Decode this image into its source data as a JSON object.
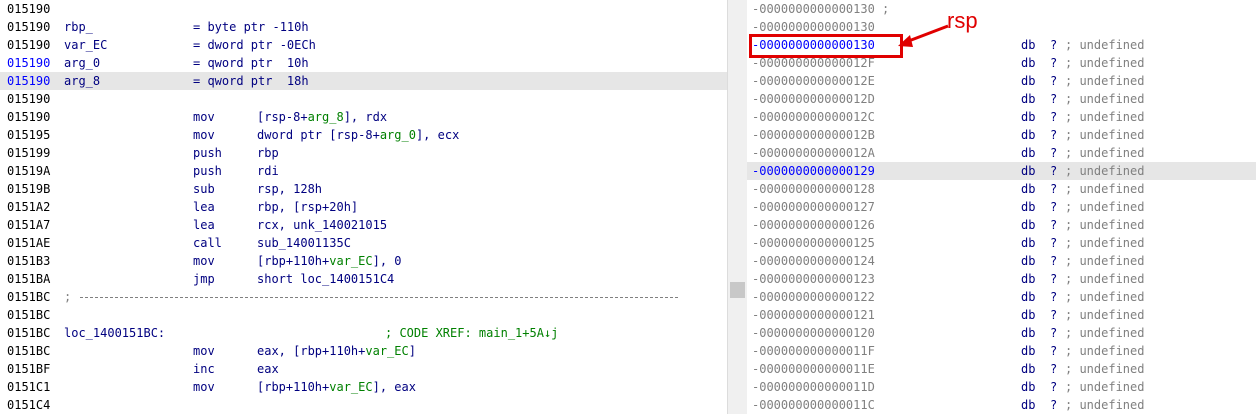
{
  "disasm": {
    "rows": [
      {
        "addr": "015190",
        "kind": "blank"
      },
      {
        "addr": "015190",
        "kind": "var",
        "name": "rbp_",
        "def": "= byte ptr -110h"
      },
      {
        "addr": "015190",
        "kind": "var",
        "name": "var_EC",
        "def": "= dword ptr -0ECh"
      },
      {
        "addr": "015190",
        "kind": "var",
        "name": "arg_0",
        "def": "= qword ptr  10h",
        "blue": true
      },
      {
        "addr": "015190",
        "kind": "var",
        "name": "arg_8",
        "def": "= qword ptr  18h",
        "blue": true,
        "highlight": true
      },
      {
        "addr": "015190",
        "kind": "blank"
      },
      {
        "addr": "015190",
        "kind": "ins",
        "mn": "mov",
        "ops": [
          [
            "[rsp-8+",
            ""
          ],
          [
            "arg_8",
            "var"
          ],
          [
            "], rdx",
            ""
          ]
        ]
      },
      {
        "addr": "015195",
        "kind": "ins",
        "mn": "mov",
        "ops": [
          [
            "dword ptr [rsp-8+",
            ""
          ],
          [
            "arg_0",
            "var"
          ],
          [
            "], ecx",
            ""
          ]
        ]
      },
      {
        "addr": "015199",
        "kind": "ins",
        "mn": "push",
        "ops": [
          [
            "rbp",
            ""
          ]
        ]
      },
      {
        "addr": "01519A",
        "kind": "ins",
        "mn": "push",
        "ops": [
          [
            "rdi",
            ""
          ]
        ]
      },
      {
        "addr": "01519B",
        "kind": "ins",
        "mn": "sub",
        "ops": [
          [
            "rsp, 128h",
            ""
          ]
        ]
      },
      {
        "addr": "0151A2",
        "kind": "ins",
        "mn": "lea",
        "ops": [
          [
            "rbp, [rsp+20h]",
            ""
          ]
        ]
      },
      {
        "addr": "0151A7",
        "kind": "ins",
        "mn": "lea",
        "ops": [
          [
            "rcx, unk_140021015",
            ""
          ]
        ]
      },
      {
        "addr": "0151AE",
        "kind": "ins",
        "mn": "call",
        "ops": [
          [
            "sub_14001135C",
            ""
          ]
        ]
      },
      {
        "addr": "0151B3",
        "kind": "ins",
        "mn": "mov",
        "ops": [
          [
            "[rbp+110h+",
            ""
          ],
          [
            "var_EC",
            "var"
          ],
          [
            "], 0",
            ""
          ]
        ]
      },
      {
        "addr": "0151BA",
        "kind": "ins",
        "mn": "jmp",
        "ops": [
          [
            "short loc_1400151C4",
            ""
          ]
        ]
      },
      {
        "addr": "0151BC",
        "kind": "sep",
        "text": ";"
      },
      {
        "addr": "0151BC",
        "kind": "blank"
      },
      {
        "addr": "0151BC",
        "kind": "label",
        "name": "loc_1400151BC:",
        "comment": "; CODE XREF: main_1+5A↓j"
      },
      {
        "addr": "0151BC",
        "kind": "ins",
        "mn": "mov",
        "ops": [
          [
            "eax, [rbp+110h+",
            ""
          ],
          [
            "var_EC",
            "var"
          ],
          [
            "]",
            ""
          ]
        ]
      },
      {
        "addr": "0151BF",
        "kind": "ins",
        "mn": "inc",
        "ops": [
          [
            "eax",
            ""
          ]
        ]
      },
      {
        "addr": "0151C1",
        "kind": "ins",
        "mn": "mov",
        "ops": [
          [
            "[rbp+110h+",
            ""
          ],
          [
            "var_EC",
            "var"
          ],
          [
            "], eax",
            ""
          ]
        ]
      },
      {
        "addr": "0151C4",
        "kind": "blank"
      }
    ]
  },
  "stack": {
    "rows": [
      {
        "off": "-0000000000000130",
        "extra": " ;"
      },
      {
        "off": "-0000000000000130",
        "extra": ""
      },
      {
        "off": "-0000000000000130",
        "db": "db",
        "q": "?",
        "cm": "; undefined",
        "blue": true
      },
      {
        "off": "-000000000000012F",
        "db": "db",
        "q": "?",
        "cm": "; undefined"
      },
      {
        "off": "-000000000000012E",
        "db": "db",
        "q": "?",
        "cm": "; undefined"
      },
      {
        "off": "-000000000000012D",
        "db": "db",
        "q": "?",
        "cm": "; undefined"
      },
      {
        "off": "-000000000000012C",
        "db": "db",
        "q": "?",
        "cm": "; undefined"
      },
      {
        "off": "-000000000000012B",
        "db": "db",
        "q": "?",
        "cm": "; undefined"
      },
      {
        "off": "-000000000000012A",
        "db": "db",
        "q": "?",
        "cm": "; undefined"
      },
      {
        "off": "-0000000000000129",
        "db": "db",
        "q": "?",
        "cm": "; undefined",
        "blue": true,
        "highlight": true
      },
      {
        "off": "-0000000000000128",
        "db": "db",
        "q": "?",
        "cm": "; undefined"
      },
      {
        "off": "-0000000000000127",
        "db": "db",
        "q": "?",
        "cm": "; undefined"
      },
      {
        "off": "-0000000000000126",
        "db": "db",
        "q": "?",
        "cm": "; undefined"
      },
      {
        "off": "-0000000000000125",
        "db": "db",
        "q": "?",
        "cm": "; undefined"
      },
      {
        "off": "-0000000000000124",
        "db": "db",
        "q": "?",
        "cm": "; undefined"
      },
      {
        "off": "-0000000000000123",
        "db": "db",
        "q": "?",
        "cm": "; undefined"
      },
      {
        "off": "-0000000000000122",
        "db": "db",
        "q": "?",
        "cm": "; undefined"
      },
      {
        "off": "-0000000000000121",
        "db": "db",
        "q": "?",
        "cm": "; undefined"
      },
      {
        "off": "-0000000000000120",
        "db": "db",
        "q": "?",
        "cm": "; undefined"
      },
      {
        "off": "-000000000000011F",
        "db": "db",
        "q": "?",
        "cm": "; undefined"
      },
      {
        "off": "-000000000000011E",
        "db": "db",
        "q": "?",
        "cm": "; undefined"
      },
      {
        "off": "-000000000000011D",
        "db": "db",
        "q": "?",
        "cm": "; undefined"
      },
      {
        "off": "-000000000000011C",
        "db": "db",
        "q": "?",
        "cm": "; undefined"
      }
    ]
  },
  "annotation": {
    "label": "rsp",
    "color": "#e00000"
  },
  "colors": {
    "address": "#000000",
    "address_blue": "#0000ff",
    "mnemonic": "#000080",
    "variable": "#008000",
    "comment": "#008000",
    "highlight": "#e6e6e6"
  }
}
